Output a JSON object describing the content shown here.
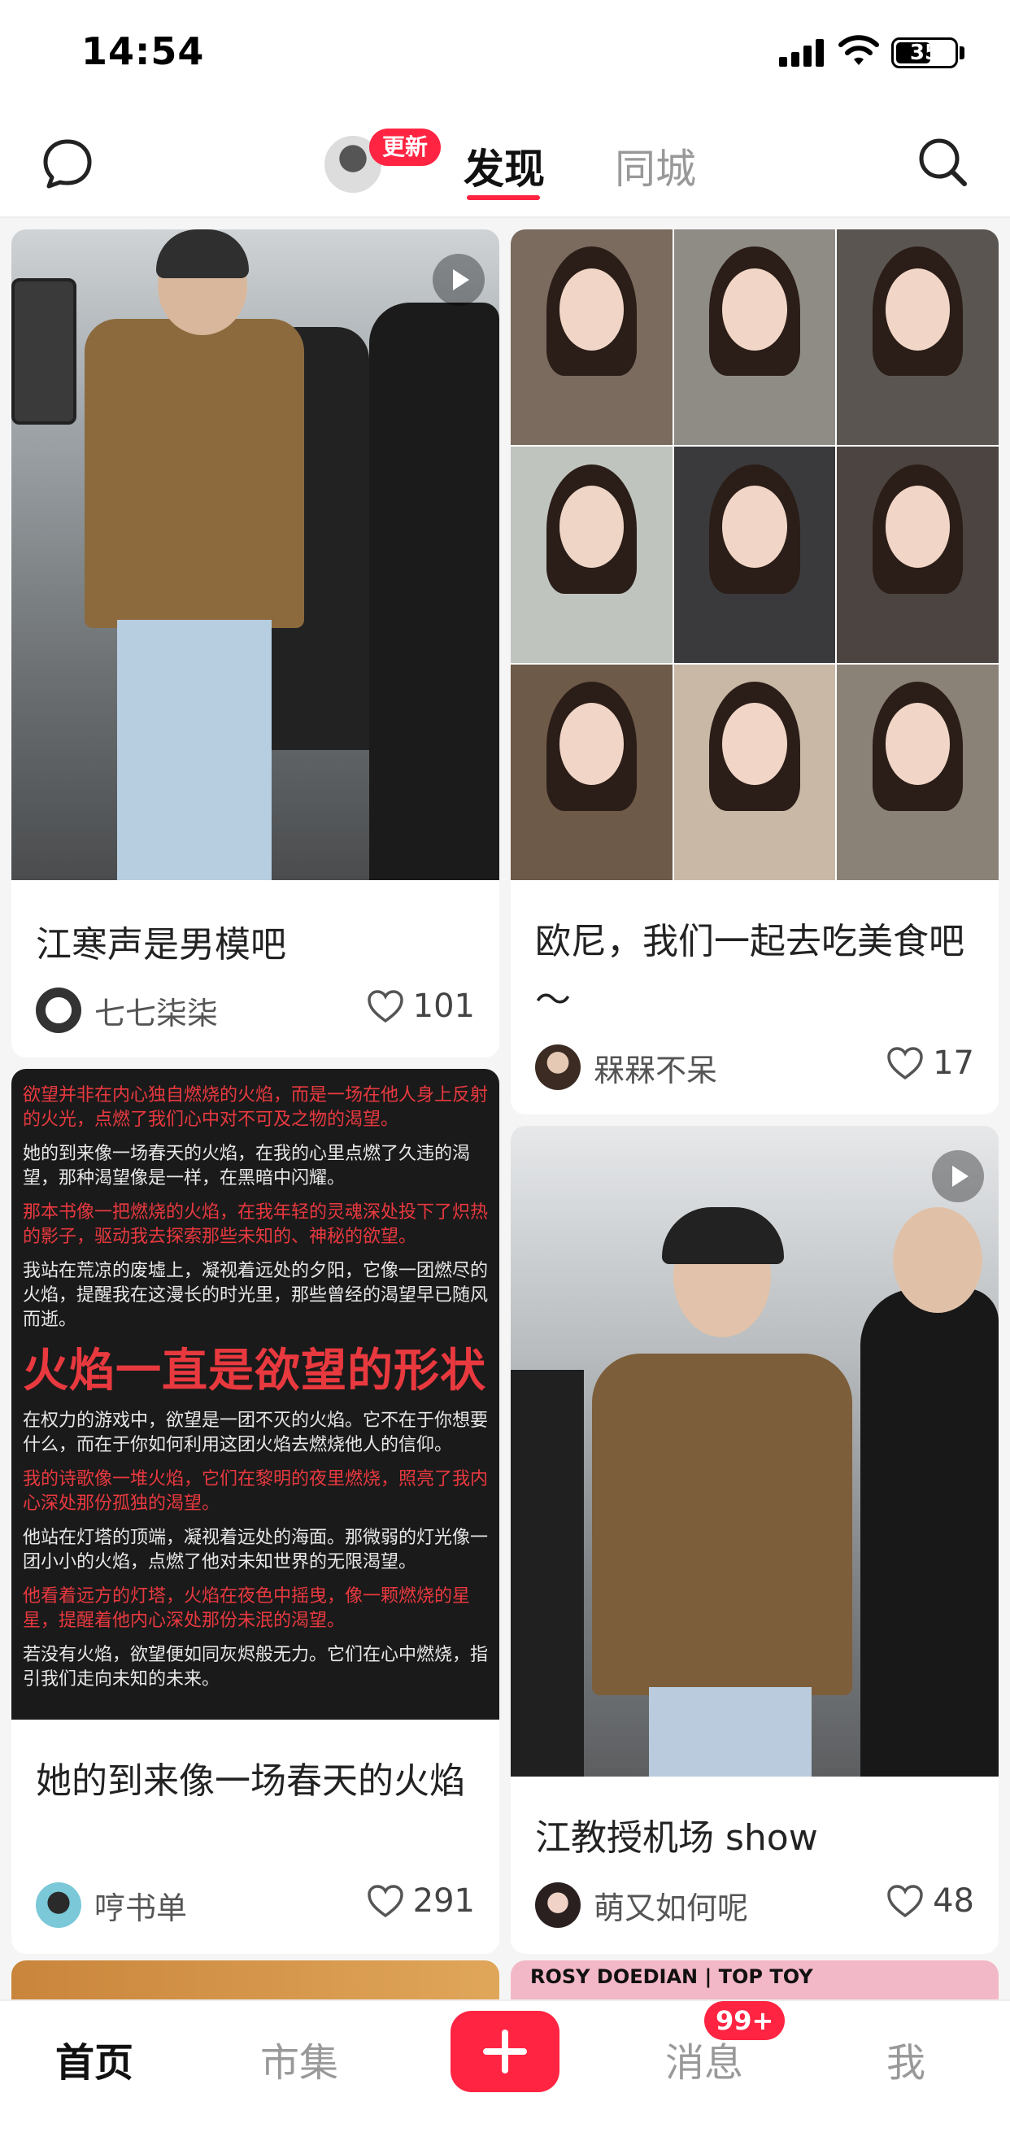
{
  "status_bar": {
    "time": "14:54",
    "battery": "35"
  },
  "top_nav": {
    "update_badge": "更新",
    "tabs": [
      {
        "label": "发现",
        "active": true
      },
      {
        "label": "同城",
        "active": false
      }
    ]
  },
  "feed": {
    "cards": [
      {
        "title": "江寒声是男模吧",
        "author": "七七柒柒",
        "likes": "101",
        "is_video": true
      },
      {
        "title": "欧尼，我们一起去吃美食吧～",
        "author": "槑槑不呆",
        "likes": "17",
        "is_video": false
      },
      {
        "title": "她的到来像一场春天的火焰",
        "author": "哼书单",
        "likes": "291",
        "is_video": false,
        "poster": {
          "p1": "欲望并非在内心独自燃烧的火焰，而是一场在他人身上反射的火光，点燃了我们心中对不可及之物的渴望。",
          "p2": "她的到来像一场春天的火焰，在我的心里点燃了久违的渴望，那种渴望像是一样，在黑暗中闪耀。",
          "p3": "那本书像一把燃烧的火焰，在我年轻的灵魂深处投下了炽热的影子，驱动我去探索那些未知的、神秘的欲望。",
          "p4": "我站在荒凉的废墟上，凝视着远处的夕阳，它像一团燃尽的火焰，提醒我在这漫长的时光里，那些曾经的渴望早已随风而逝。",
          "headline": "火焰一直是欲望的形状",
          "p5": "在权力的游戏中，欲望是一团不灭的火焰。它不在于你想要什么，而在于你如何利用这团火焰去燃烧他人的信仰。",
          "p6": "我的诗歌像一堆火焰，它们在黎明的夜里燃烧，照亮了我内心深处那份孤独的渴望。",
          "p7": "他站在灯塔的顶端，凝视着远处的海面。那微弱的灯光像一团小小的火焰，点燃了他对未知世界的无限渴望。",
          "p8": "他看着远方的灯塔，火焰在夜色中摇曳，像一颗燃烧的星星，提醒着他内心深处那份未泯的渴望。",
          "p9": "若没有火焰，欲望便如同灰烬般无力。它们在心中燃烧，指引我们走向未知的未来。"
        }
      },
      {
        "title": "江教授机场 show",
        "author": "萌又如何呢",
        "likes": "48",
        "is_video": true
      }
    ],
    "teasers": [
      {
        "text": ""
      },
      {
        "text": "ROSY DOEDIAN | TOP TOY"
      }
    ]
  },
  "bottom_nav": {
    "home": "首页",
    "market": "市集",
    "messages": "消息",
    "messages_badge": "99+",
    "me": "我"
  },
  "colors": {
    "accent": "#ff2442"
  }
}
